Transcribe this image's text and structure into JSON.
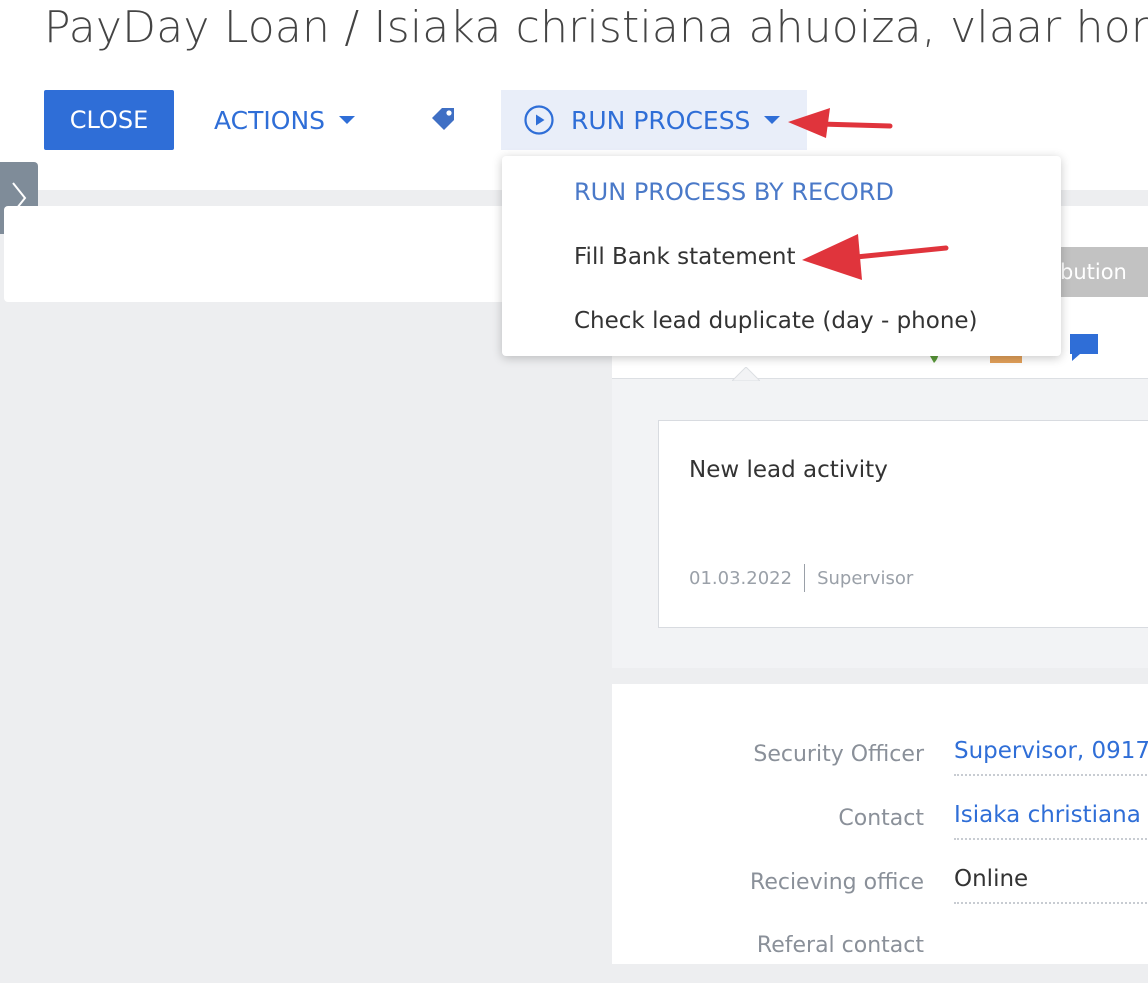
{
  "page": {
    "title": "PayDay Loan / Isiaka christiana ahuoiza, vlaar home"
  },
  "toolbar": {
    "close_label": "CLOSE",
    "actions_label": "ACTIONS",
    "run_process_label": "RUN PROCESS",
    "tag_icon": "tag-icon",
    "run_icon": "play-circle-icon"
  },
  "run_process_menu": {
    "items": [
      {
        "label": "RUN PROCESS BY RECORD",
        "kind": "header"
      },
      {
        "label": "Fill Bank statement",
        "kind": "item"
      },
      {
        "label": "Check lead duplicate (day - phone)",
        "kind": "item"
      }
    ]
  },
  "tabs": {
    "partial_tab_label": "bution"
  },
  "activity": {
    "title": "New lead activity",
    "date": "01.03.2022",
    "author": "Supervisor"
  },
  "details": {
    "fields": [
      {
        "label": "Security Officer",
        "value": "Supervisor, 0917",
        "link": true
      },
      {
        "label": "Contact",
        "value": "Isiaka christiana",
        "link": true
      },
      {
        "label": "Recieving office",
        "value": "Online",
        "link": false
      },
      {
        "label": "Referal contact",
        "value": "",
        "link": false
      }
    ]
  },
  "colors": {
    "accent": "#2f6ed7",
    "annotation_arrow": "#e0343c"
  }
}
